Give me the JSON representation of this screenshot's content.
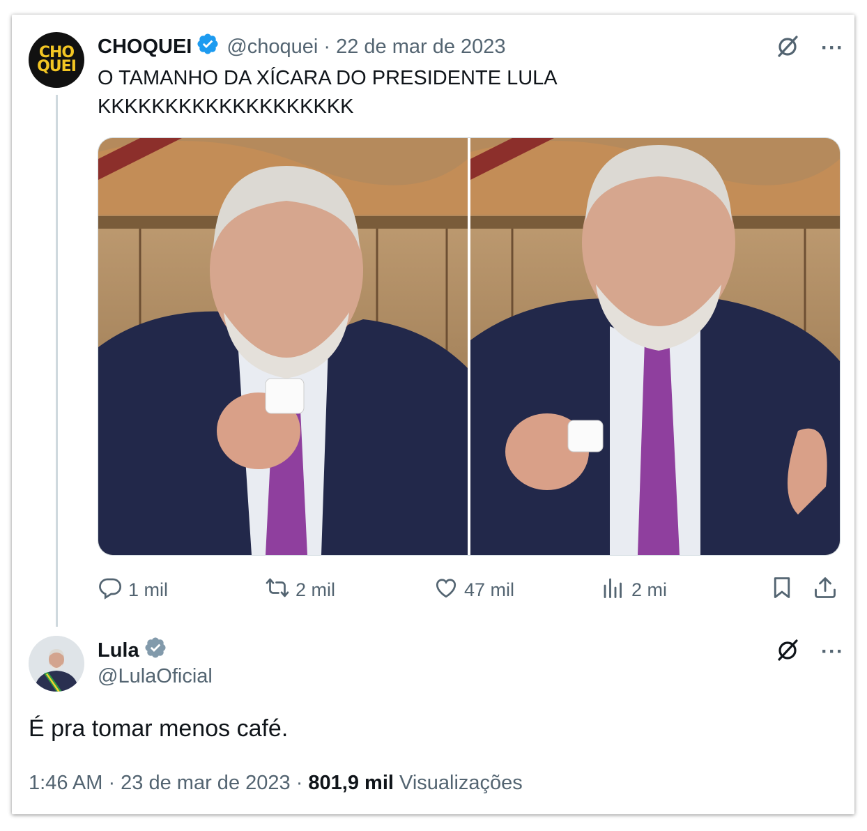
{
  "colors": {
    "text": "#0f1419",
    "secondary": "#536471",
    "verified": "#1d9bf0",
    "verified_gray": "#829aab",
    "border": "#cfd9de"
  },
  "original_tweet": {
    "display_name": "CHOQUEI",
    "handle": "@choquei",
    "date": "· 22 de mar de 2023",
    "text_line1": "O TAMANHO DA XÍCARA DO PRESIDENTE LULA",
    "text_line2": "KKKKKKKKKKKKKKKKKKK",
    "avatar_text_top": "CHO",
    "avatar_text_bottom": "QUEI",
    "verified_icon": "verified-badge-icon",
    "actions": {
      "replies": "1 mil",
      "retweets": "2 mil",
      "likes": "47 mil",
      "views": "2 mi"
    }
  },
  "reply_tweet": {
    "display_name": "Lula",
    "handle": "@LulaOficial",
    "text": "É pra tomar menos café.",
    "verified_icon": "gray-verified-badge-icon",
    "footer": {
      "time": "1:46 AM",
      "date": "· 23 de mar de 2023 ·",
      "views_count": "801,9 mil",
      "views_label": "Visualizações"
    }
  },
  "more_label": "···"
}
